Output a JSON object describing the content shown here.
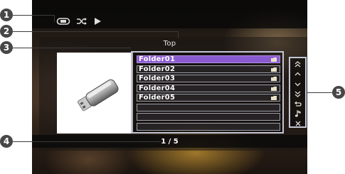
{
  "screen": {
    "title": "Top",
    "status_icons": [
      "repeat-icon",
      "shuffle-icon",
      "play-icon"
    ]
  },
  "list": {
    "items": [
      {
        "label": "Folder01",
        "selected": true,
        "icon": "folder-icon"
      },
      {
        "label": "Folder02",
        "selected": false,
        "icon": "folder-icon"
      },
      {
        "label": "Folder03",
        "selected": false,
        "icon": "folder-icon"
      },
      {
        "label": "Folder04",
        "selected": false,
        "icon": "folder-icon"
      },
      {
        "label": "Folder05",
        "selected": false,
        "icon": "folder-icon"
      },
      {
        "label": "",
        "selected": false
      },
      {
        "label": "",
        "selected": false
      },
      {
        "label": "",
        "selected": false
      }
    ]
  },
  "page_indicator": "1 / 5",
  "controls": [
    "page-up-icon",
    "up-icon",
    "down-icon",
    "page-down-icon",
    "return-icon",
    "music-icon",
    "close-icon"
  ],
  "callouts": [
    "1",
    "2",
    "3",
    "4",
    "5"
  ],
  "colors": {
    "selection": "#8a5bd0",
    "frame": "#c3c6d6",
    "badge": "#474747"
  }
}
